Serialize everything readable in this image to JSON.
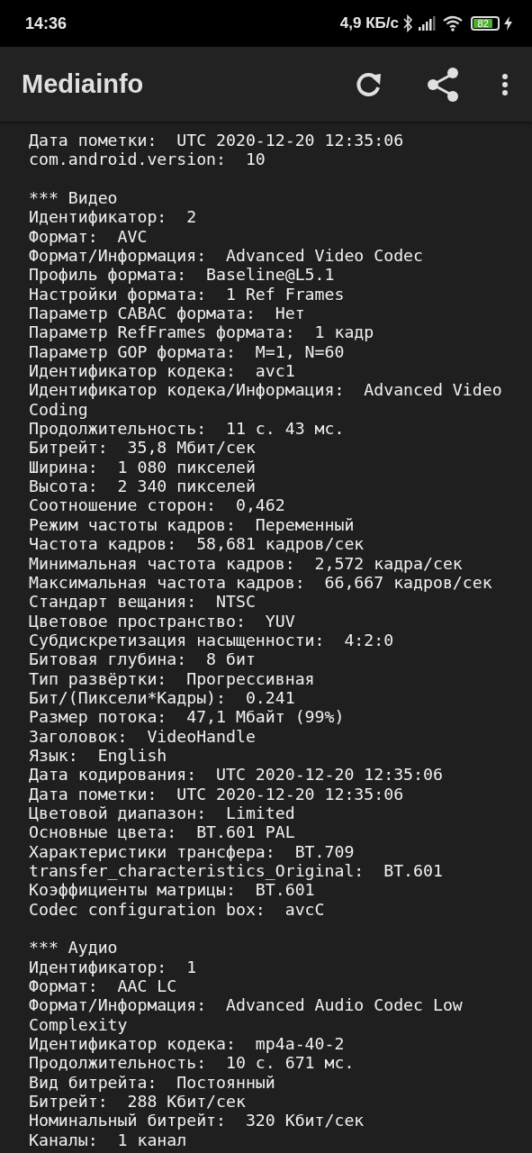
{
  "status_bar": {
    "time": "14:36",
    "net_speed": "4,9 КБ/с",
    "battery": "82"
  },
  "app_bar": {
    "title": "Mediainfo"
  },
  "sections": [
    {
      "lines": [
        "Дата пометки:  UTC 2020-12-20 12:35:06",
        "com.android.version:  10"
      ]
    },
    {
      "lines": [
        "*** Видео",
        "Идентификатор:  2",
        "Формат:  AVC",
        "Формат/Информация:  Advanced Video Codec",
        "Профиль формата:  Baseline@L5.1",
        "Настройки формата:  1 Ref Frames",
        "Параметр CABAC формата:  Нет",
        "Параметр RefFrames формата:  1 кадр",
        "Параметр GOP формата:  M=1, N=60",
        "Идентификатор кодека:  avc1",
        "Идентификатор кодека/Информация:  Advanced Video Coding",
        "Продолжительность:  11 с. 43 мс.",
        "Битрейт:  35,8 Мбит/сек",
        "Ширина:  1 080 пикселей",
        "Высота:  2 340 пикселей",
        "Соотношение сторон:  0,462",
        "Режим частоты кадров:  Переменный",
        "Частота кадров:  58,681 кадров/сек",
        "Минимальная частота кадров:  2,572 кадра/сек",
        "Максимальная частота кадров:  66,667 кадров/сек",
        "Стандарт вещания:  NTSC",
        "Цветовое пространство:  YUV",
        "Субдискретизация насыщенности:  4:2:0",
        "Битовая глубина:  8 бит",
        "Тип развёртки:  Прогрессивная",
        "Бит/(Пиксели*Кадры):  0.241",
        "Размер потока:  47,1 Мбайт (99%)",
        "Заголовок:  VideoHandle",
        "Язык:  English",
        "Дата кодирования:  UTC 2020-12-20 12:35:06",
        "Дата пометки:  UTC 2020-12-20 12:35:06",
        "Цветовой диапазон:  Limited",
        "Основные цвета:  BT.601 PAL",
        "Характеристики трансфера:  BT.709",
        "transfer_characteristics_Original:  BT.601",
        "Коэффициенты матрицы:  BT.601",
        "Codec configuration box:  avcC"
      ]
    },
    {
      "lines": [
        "*** Аудио",
        "Идентификатор:  1",
        "Формат:  AAC LC",
        "Формат/Информация:  Advanced Audio Codec Low Complexity",
        "Идентификатор кодека:  mp4a-40-2",
        "Продолжительность:  10 с. 671 мс.",
        "Вид битрейта:  Постоянный",
        "Битрейт:  288 Кбит/сек",
        "Номинальный битрейт:  320 Кбит/сек",
        "Каналы:  1 канал"
      ]
    }
  ]
}
